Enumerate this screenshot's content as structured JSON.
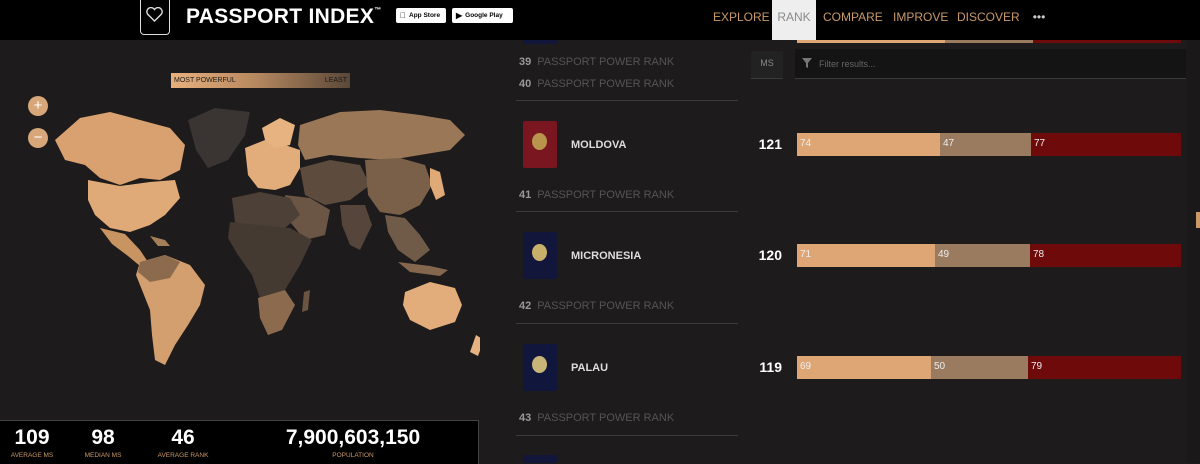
{
  "header": {
    "brand": "PASSPORT INDEX",
    "trademark": "™",
    "app_store": "App Store",
    "google_play": "Google Play",
    "nav": [
      {
        "label": "EXPLORE",
        "active": false
      },
      {
        "label": "RANK",
        "active": true
      },
      {
        "label": "COMPARE",
        "active": false
      },
      {
        "label": "IMPROVE",
        "active": false
      },
      {
        "label": "DISCOVER",
        "active": false
      },
      {
        "label": "•••",
        "active": false
      }
    ]
  },
  "map": {
    "legend_most": "MOST POWERFUL",
    "legend_least": "LEAST",
    "zoom_in": "+",
    "zoom_out": "−"
  },
  "stats": [
    {
      "value": "109",
      "label": "AVERAGE MS"
    },
    {
      "value": "98",
      "label": "MEDIAN MS"
    },
    {
      "value": "46",
      "label": "AVERAGE RANK"
    },
    {
      "value": "7,900,603,150",
      "label": "POPULATION"
    }
  ],
  "list": {
    "ms_header": "MS",
    "filter_placeholder": "Filter results...",
    "rank_suffix": "PASSPORT POWER RANK",
    "ranks_top": [
      {
        "num": "39",
        "label": "PASSPORT POWER RANK"
      },
      {
        "num": "40",
        "label": "PASSPORT POWER RANK"
      }
    ],
    "rows": [
      {
        "country": "MOLDOVA",
        "ms": "121",
        "a": 74,
        "b": 47,
        "c": 77,
        "rank_num": "41",
        "rank_label": "PASSPORT POWER RANK",
        "cover": "#7a1620",
        "emblem": "#b8944c"
      },
      {
        "country": "MICRONESIA",
        "ms": "120",
        "a": 71,
        "b": 49,
        "c": 78,
        "rank_num": "42",
        "rank_label": "PASSPORT POWER RANK",
        "cover": "#11163a",
        "emblem": "#c8b06a"
      },
      {
        "country": "PALAU",
        "ms": "119",
        "a": 69,
        "b": 50,
        "c": 79,
        "rank_num": "43",
        "rank_label": "PASSPORT POWER RANK",
        "cover": "#11173c",
        "emblem": "#c9b47a"
      }
    ]
  },
  "colors": {
    "visa_free": "#dfa675",
    "visa_on_arrival": "#9b7b60",
    "visa_required": "#6e0a0a",
    "accent": "#c9996a"
  }
}
